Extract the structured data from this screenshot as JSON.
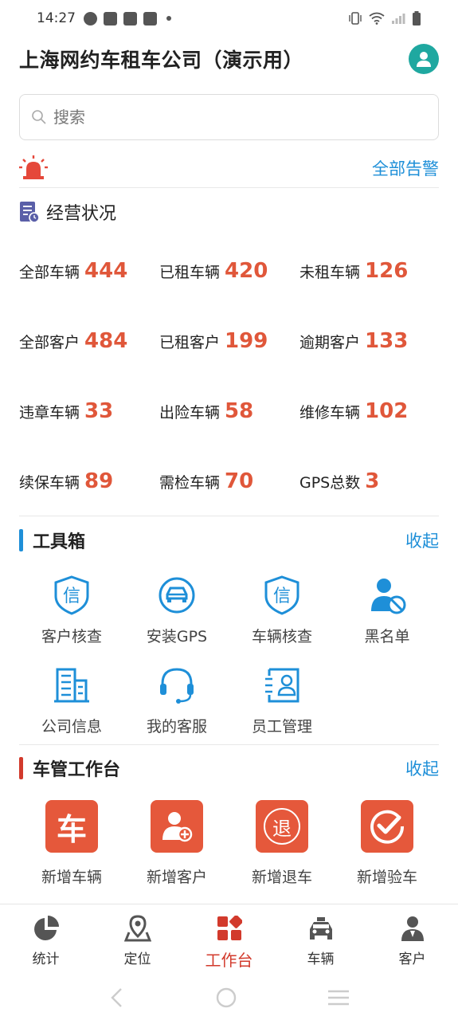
{
  "status_bar": {
    "time": "14:27"
  },
  "header": {
    "title": "上海网约车租车公司（演示用）"
  },
  "search": {
    "placeholder": "搜索"
  },
  "alarm": {
    "link": "全部告警"
  },
  "operations": {
    "title": "经营状况",
    "stats": [
      {
        "label": "全部车辆",
        "value": "444"
      },
      {
        "label": "已租车辆",
        "value": "420"
      },
      {
        "label": "未租车辆",
        "value": "126"
      },
      {
        "label": "全部客户",
        "value": "484"
      },
      {
        "label": "已租客户",
        "value": "199"
      },
      {
        "label": "逾期客户",
        "value": "133"
      },
      {
        "label": "违章车辆",
        "value": "33"
      },
      {
        "label": "出险车辆",
        "value": "58"
      },
      {
        "label": "维修车辆",
        "value": "102"
      },
      {
        "label": "续保车辆",
        "value": "89"
      },
      {
        "label": "需检车辆",
        "value": "70"
      },
      {
        "label": "GPS总数",
        "value": "3"
      }
    ]
  },
  "toolbox": {
    "title": "工具箱",
    "toggle": "收起",
    "items": [
      {
        "label": "客户核查",
        "icon": "shield-credit-icon"
      },
      {
        "label": "安装GPS",
        "icon": "car-circle-icon"
      },
      {
        "label": "车辆核查",
        "icon": "shield-credit-icon"
      },
      {
        "label": "黑名单",
        "icon": "user-blocked-icon"
      },
      {
        "label": "公司信息",
        "icon": "building-icon"
      },
      {
        "label": "我的客服",
        "icon": "headset-icon"
      },
      {
        "label": "员工管理",
        "icon": "id-card-icon"
      }
    ]
  },
  "workbench": {
    "title": "车管工作台",
    "toggle": "收起",
    "items": [
      {
        "label": "新增车辆",
        "glyph": "车"
      },
      {
        "label": "新增客户",
        "glyph": ""
      },
      {
        "label": "新增退车",
        "glyph": "退"
      },
      {
        "label": "新增验车",
        "glyph": ""
      }
    ]
  },
  "tabs": [
    {
      "label": "统计",
      "icon": "pie-chart-icon"
    },
    {
      "label": "定位",
      "icon": "map-pin-icon"
    },
    {
      "label": "工作台",
      "icon": "dashboard-grid-icon",
      "active": true
    },
    {
      "label": "车辆",
      "icon": "taxi-icon"
    },
    {
      "label": "客户",
      "icon": "person-icon"
    }
  ],
  "colors": {
    "accent_blue": "#1e8fd8",
    "accent_red": "#e5583b",
    "active_tab": "#d23a2c",
    "avatar": "#1fa8a0"
  }
}
